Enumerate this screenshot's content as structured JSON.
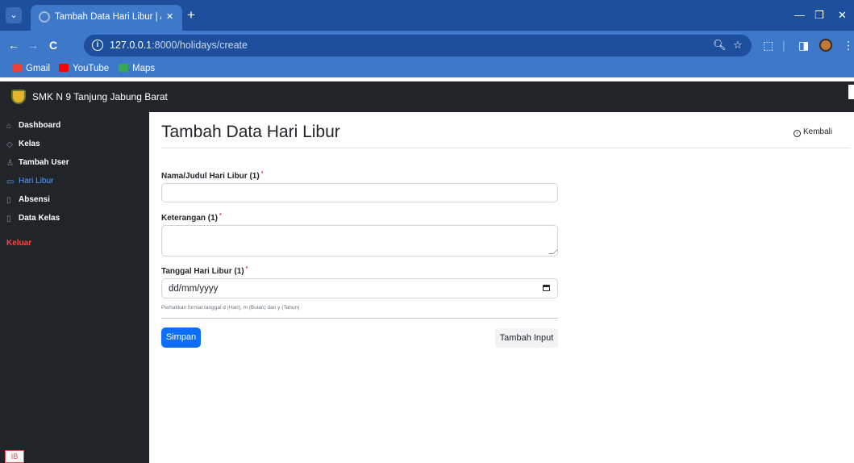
{
  "browser": {
    "tab_title": "Tambah Data Hari Libur | Absen",
    "tab_close": "✕",
    "new_tab": "+",
    "url_host": "127.0.0.1",
    "url_path": ":8000/holidays/create",
    "bookmarks": [
      {
        "label": "Gmail",
        "icon": "gmail-icon",
        "color": "#ea4335"
      },
      {
        "label": "YouTube",
        "icon": "youtube-icon",
        "color": "#ff0000"
      },
      {
        "label": "Maps",
        "icon": "maps-icon",
        "color": "#34a853"
      }
    ],
    "chrome_color": "#3d78c9"
  },
  "app": {
    "brand": "SMK N 9 Tanjung Jabung Barat",
    "sidebar": [
      {
        "label": "Dashboard",
        "icon": "home-icon",
        "active": false
      },
      {
        "label": "Kelas",
        "icon": "tag-icon",
        "active": false
      },
      {
        "label": "Tambah User",
        "icon": "users-icon",
        "active": false
      },
      {
        "label": "Hari Libur",
        "icon": "calendar-icon",
        "active": true
      },
      {
        "label": "Absensi",
        "icon": "file-icon",
        "active": false
      },
      {
        "label": "Data Kelas",
        "icon": "file-icon",
        "active": false
      }
    ],
    "logout": "Keluar",
    "corner_badge": "IB"
  },
  "page": {
    "title": "Tambah Data Hari Libur",
    "back_label": "Kembali"
  },
  "form": {
    "name_label": "Nama/Judul Hari Libur (1)",
    "name_value": "",
    "desc_label": "Keterangan (1)",
    "desc_value": "",
    "date_label": "Tanggal Hari Libur (1)",
    "date_placeholder": "dd/mm/yyyy",
    "required_mark": "*",
    "help_text": "Perhatikan format tanggal d (Hari), m (Bulan) dan y (Tahun)",
    "submit_label": "Simpan",
    "add_input_label": "Tambah Input"
  },
  "colors": {
    "primary": "#0d6efd",
    "sidebar_bg": "#212529",
    "active_link": "#5aa0ff",
    "danger": "#ff4242"
  }
}
